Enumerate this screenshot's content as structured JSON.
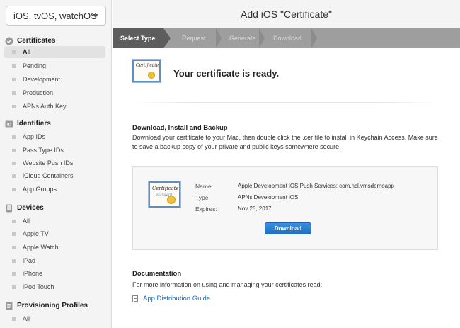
{
  "sidebar": {
    "platform_select": "iOS, tvOS, watchOS",
    "sections": {
      "certificates": {
        "label": "Certificates",
        "icon": "checkmark-badge-icon",
        "items": [
          "All",
          "Pending",
          "Development",
          "Production",
          "APNs Auth Key"
        ],
        "active": "All"
      },
      "identifiers": {
        "label": "Identifiers",
        "icon": "id-badge-icon",
        "items": [
          "App IDs",
          "Pass Type IDs",
          "Website Push IDs",
          "iCloud Containers",
          "App Groups"
        ]
      },
      "devices": {
        "label": "Devices",
        "icon": "device-icon",
        "items": [
          "All",
          "Apple TV",
          "Apple Watch",
          "iPad",
          "iPhone",
          "iPod Touch"
        ]
      },
      "profiles": {
        "label": "Provisioning Profiles",
        "icon": "document-icon",
        "items": [
          "All"
        ]
      }
    }
  },
  "main": {
    "title": "Add iOS \"Certificate\"",
    "steps": [
      "Select Type",
      "Request",
      "Generate",
      "Download"
    ],
    "current_step": "Select Type",
    "ready_message": "Your certificate is ready.",
    "download_section": {
      "heading": "Download, Install and Backup",
      "description": "Download your certificate to your Mac, then double click the .cer file to install in Keychain Access. Make sure to save a backup copy of your private and public keys somewhere secure."
    },
    "certificate": {
      "name_label": "Name:",
      "name_value": "Apple Development iOS Push Services: com.hcl.vmsdemoapp",
      "type_label": "Type:",
      "type_value": "APNs Development iOS",
      "expires_label": "Expires:",
      "expires_value": "Nov 25, 2017",
      "download_button": "Download"
    },
    "documentation": {
      "heading": "Documentation",
      "description": "For more information on using and managing your certificates read:",
      "link": "App Distribution Guide"
    }
  },
  "colors": {
    "accent": "#1f6fc3",
    "link": "#0a6fd6",
    "step_bar": "#9e9e9e",
    "step_current": "#5d5d5d"
  }
}
